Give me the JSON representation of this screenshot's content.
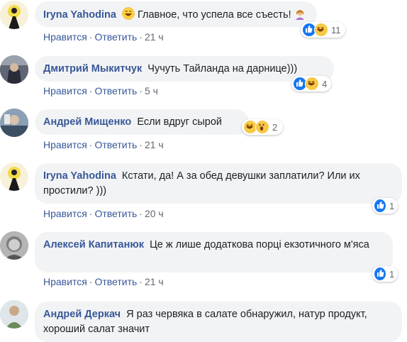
{
  "comments": [
    {
      "author": "Iryna Yahodina",
      "text": "Главное, что успела все съесть!",
      "actions": {
        "like": "Нравится",
        "reply": "Ответить",
        "time": "21 ч"
      },
      "reactions": {
        "count": "11"
      }
    },
    {
      "author": "Дмитрий Мыкитчук",
      "text": "Чучуть Тайланда на дарнице)))",
      "actions": {
        "like": "Нравится",
        "reply": "Ответить",
        "time": "5 ч"
      },
      "reactions": {
        "count": "4"
      }
    },
    {
      "author": "Андрей Мищенко",
      "text": "Если вдруг сырой",
      "actions": {
        "like": "Нравится",
        "reply": "Ответить",
        "time": "21 ч"
      },
      "reactions": {
        "count": "2"
      }
    },
    {
      "author": "Iryna Yahodina",
      "text": "Кстати, да! А за обед девушки заплатили? Или их простили? )))",
      "actions": {
        "like": "Нравится",
        "reply": "Ответить",
        "time": "20 ч"
      },
      "reactions": {
        "count": "1"
      }
    },
    {
      "author": "Алексей Капитанюк",
      "text": "Це ж лише додаткова порці екзотичного м'яса",
      "actions": {
        "like": "Нравится",
        "reply": "Ответить",
        "time": "21 ч"
      },
      "reactions": {
        "count": "1"
      }
    },
    {
      "author": "Андрей Деркач",
      "text": "Я раз червяка в салате обнаружил, натур продукт, хороший салат значит"
    }
  ],
  "colors": {
    "link": "#385898",
    "bubble": "#f2f3f5",
    "meta": "#606770",
    "like": "#1877f2"
  },
  "icons": [
    "grinning-emoji-icon",
    "woman-shrugging-emoji-icon",
    "like-reaction-icon",
    "haha-reaction-icon",
    "wow-reaction-icon"
  ]
}
